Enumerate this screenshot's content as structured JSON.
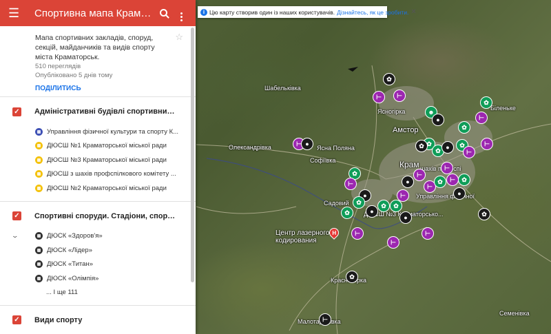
{
  "map": {
    "labels": [
      {
        "id": "shabelkivka",
        "text": "Шабельківка"
      },
      {
        "id": "oleksandrivka",
        "text": "Олександрівка"
      },
      {
        "id": "sofiivka",
        "text": "Софіївка"
      },
      {
        "id": "yasna-poliana",
        "text": "Ясна Поляна"
      },
      {
        "id": "yasnohirka",
        "text": "Ясногірка"
      },
      {
        "id": "amstor",
        "text": "Амстор"
      },
      {
        "id": "bilenke",
        "text": "Біленьке"
      },
      {
        "id": "kramatorsk",
        "text": "Крам"
      },
      {
        "id": "sadovyi",
        "text": "Садовий"
      },
      {
        "id": "laser",
        "text": "Центр лазерного кодирования"
      },
      {
        "id": "krasnohorka",
        "text": "Красногорка"
      },
      {
        "id": "malotaranivka",
        "text": "Малотаранівка"
      },
      {
        "id": "semenivka",
        "text": "Семенівка"
      },
      {
        "id": "dyusch-label",
        "text": "ДЮСШ №3 Краматорсько..."
      },
      {
        "id": "upr-label",
        "text": "Управління фізичної"
      },
      {
        "id": "shakh-label",
        "text": "шахів профспі"
      }
    ]
  },
  "banner": {
    "text": "Цю карту створив один із наших користувачів.",
    "link": "Дізнайтесь, як це зробити.",
    "close": "✕"
  },
  "header": {
    "title": "Спортивна мапа Крамат...",
    "menu_icon": "menu-icon",
    "search_icon": "search-icon",
    "more_icon": "more-vert-icon",
    "color": "#db4437"
  },
  "info": {
    "description": "Мапа спортивних закладів, споруд, секцій, майданчиків та видів спорту міста Краматорськ.",
    "views": "510 переглядів",
    "published": "Опубліковано 5 днів тому",
    "share": "ПОДІЛИТИСЬ"
  },
  "layers": [
    {
      "title": "Адміністративні будівлі спортивних о...",
      "items": [
        {
          "label": "Управління фізичної культури та спорту К...",
          "color": "blue"
        },
        {
          "label": "ДЮСШ №1 Краматорської міської ради",
          "color": "yellow"
        },
        {
          "label": "ДЮСШ №3 Краматорської міської ради",
          "color": "yellow"
        },
        {
          "label": "ДЮСШ з шахів профспілкового комітету ...",
          "color": "yellow"
        },
        {
          "label": "ДЮСШ №2 Краматорської міської ради",
          "color": "yellow"
        }
      ]
    },
    {
      "title": "Спортивні споруди. Стадіони, спортив...",
      "items": [
        {
          "label": "ДЮСК «Здоров'я»",
          "color": "black"
        },
        {
          "label": "ДЮСК «Лідер»",
          "color": "black"
        },
        {
          "label": "ДЮСК «Титан»",
          "color": "black"
        },
        {
          "label": "ДЮСК «Олімпія»",
          "color": "black"
        }
      ],
      "more": "... І ще 111"
    },
    {
      "title": "Види спорту",
      "items": []
    }
  ]
}
